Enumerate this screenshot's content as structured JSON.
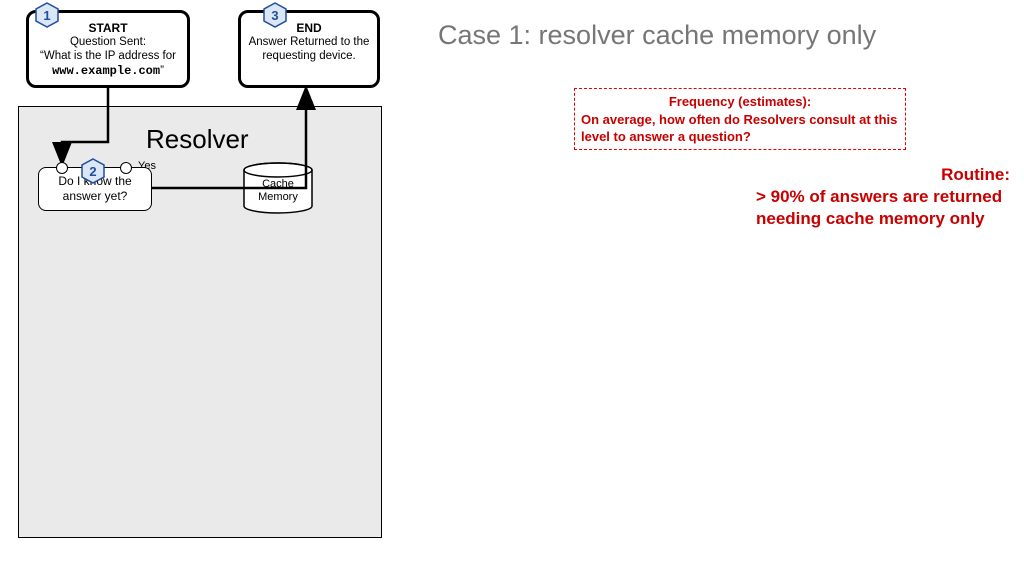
{
  "case_title": "Case 1: resolver cache memory only",
  "start": {
    "badge": "1",
    "title": "START",
    "line1": "Question Sent:",
    "line2_prefix": "“What is the IP address for",
    "domain": "www.example.com",
    "line2_suffix": "”"
  },
  "end": {
    "badge": "3",
    "title": "END",
    "line1": "Answer Returned to the",
    "line2": "requesting device."
  },
  "resolver_label": "Resolver",
  "decision": {
    "badge": "2",
    "line1": "Do I know the",
    "line2": "answer yet?",
    "yes": "Yes"
  },
  "cache": {
    "line1": "Cache",
    "line2": "Memory"
  },
  "frequency": {
    "title": "Frequency (estimates):",
    "body": "On average, how often do Resolvers consult at this level to answer a question?"
  },
  "routine": {
    "title": "Routine:",
    "line1": "> 90% of answers are returned",
    "line2": "needing cache memory only"
  }
}
